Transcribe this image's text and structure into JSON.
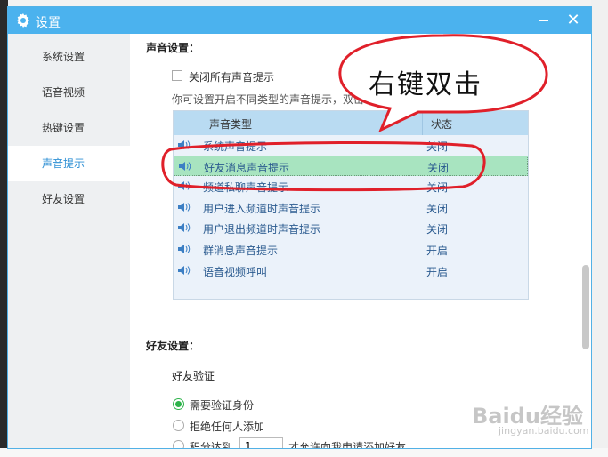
{
  "window": {
    "title": "设置",
    "minimize_label": "—",
    "close_label": "✕"
  },
  "sidebar": {
    "items": [
      {
        "label": "系统设置"
      },
      {
        "label": "语音视频"
      },
      {
        "label": "热键设置"
      },
      {
        "label": "声音提示",
        "active": true
      },
      {
        "label": "好友设置"
      }
    ]
  },
  "sound": {
    "section_title": "声音设置：",
    "mute_all_label": "关闭所有声音提示",
    "hint": "你可设置开启不同类型的声音提示，双击可以切换\"状态\"。",
    "table": {
      "col_type": "声音类型",
      "col_status": "状态",
      "rows": [
        {
          "type": "系统声音提示",
          "status": "关闭"
        },
        {
          "type": "好友消息声音提示",
          "status": "关闭",
          "selected": true
        },
        {
          "type": "频道私聊声音提示",
          "status": "关闭"
        },
        {
          "type": "用户进入频道时声音提示",
          "status": "关闭"
        },
        {
          "type": "用户退出频道时声音提示",
          "status": "关闭"
        },
        {
          "type": "群消息声音提示",
          "status": "开启"
        },
        {
          "type": "语音视频呼叫",
          "status": "开启"
        }
      ]
    }
  },
  "friend": {
    "section_title": "好友设置：",
    "verify_title": "好友验证",
    "options": [
      {
        "label": "需要验证身份",
        "checked": true
      },
      {
        "label": "拒绝任何人添加",
        "checked": false
      },
      {
        "label": "积分达到",
        "checked": false
      }
    ],
    "score_value": "1",
    "score_suffix": "才允许向我申请添加好友"
  },
  "annotation": {
    "bubble_text": "右键双击",
    "color": "#e0202a"
  },
  "watermark": {
    "text": "Baidu经验",
    "sub": "jingyan.baidu.com"
  }
}
